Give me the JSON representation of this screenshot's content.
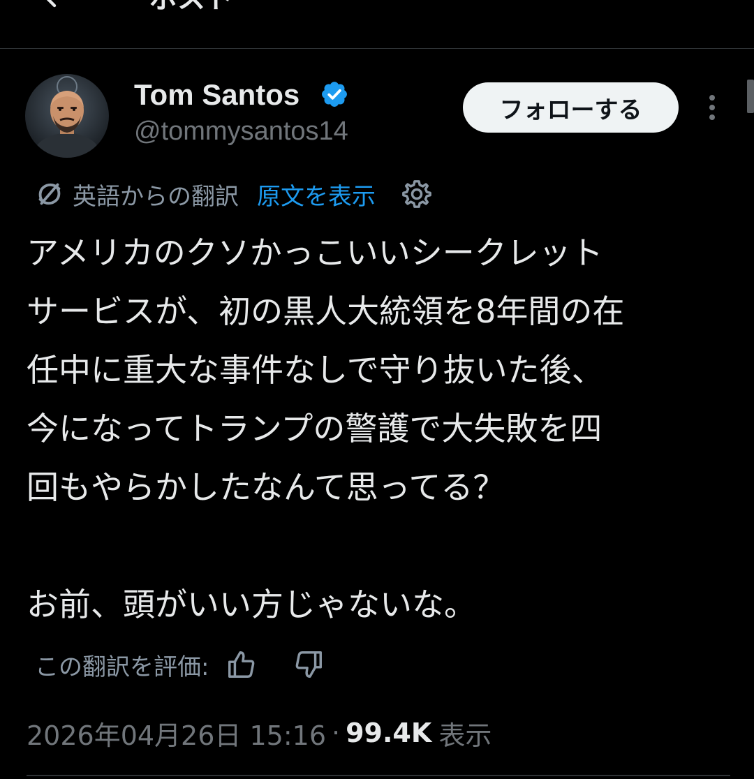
{
  "header": {
    "title": "ポスト",
    "back_icon": "arrow-left-icon"
  },
  "author": {
    "display_name": "Tom Santos",
    "handle": "@tommysantos14",
    "verified": true,
    "follow_label": "フォローする"
  },
  "translation": {
    "label": "英語からの翻訳",
    "show_original": "原文を表示"
  },
  "tweet": {
    "lines": [
      "アメリカのクソかっこいいシークレット",
      "サービスが、初の黒人大統領を8年間の在",
      "任中に重大な事件なしで守り抜いた後、",
      "今になってトランプの警護で大失敗を四",
      "回もやらかしたなんて思ってる？",
      "お前、頭がいい方じゃないな。"
    ]
  },
  "rating": {
    "label": "この翻訳を評価:"
  },
  "meta": {
    "timestamp": "2026年04月26日 15:16",
    "separator": "·",
    "views": "99.4K",
    "views_label": "表示"
  },
  "colors": {
    "background": "#000000",
    "text": "#e7e9ea",
    "muted": "#71767b",
    "link": "#1d9bf0",
    "verified": "#1d9bf0",
    "follow_bg": "#eff3f4"
  }
}
